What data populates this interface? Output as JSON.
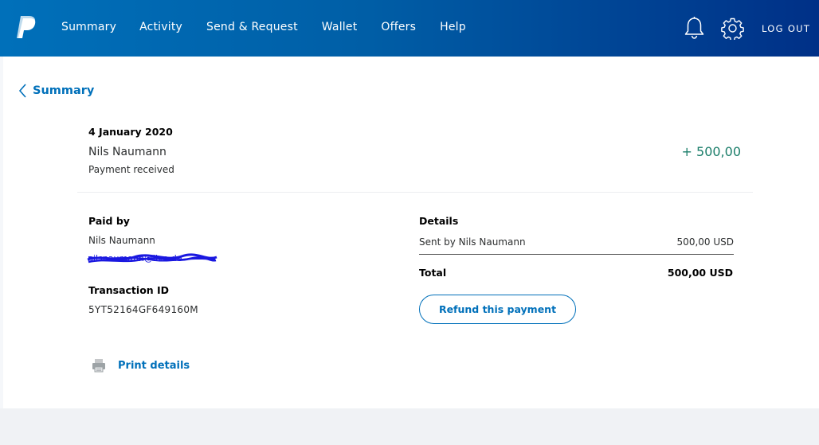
{
  "nav": {
    "items": [
      "Summary",
      "Activity",
      "Send & Request",
      "Wallet",
      "Offers",
      "Help"
    ],
    "logout": "LOG OUT"
  },
  "back": {
    "label": "Summary"
  },
  "transaction": {
    "date": "4 January 2020",
    "name": "Nils Naumann",
    "type": "Payment received",
    "amount": "+ 500,00"
  },
  "paid_by": {
    "label": "Paid by",
    "name": "Nils Naumann",
    "email": "nilsnaumann@live.de"
  },
  "transaction_id": {
    "label": "Transaction ID",
    "value": "5YT52164GF649160M"
  },
  "details": {
    "label": "Details",
    "sent_by_label": "Sent by Nils Naumann",
    "sent_by_amount": "500,00 USD",
    "total_label": "Total",
    "total_amount": "500,00 USD"
  },
  "actions": {
    "refund": "Refund this payment",
    "print": "Print details"
  },
  "colors": {
    "brand_blue": "#0070ba",
    "header_dark": "#003087",
    "amount_green": "#1b7e6a"
  },
  "icons": [
    "paypal-logo-icon",
    "bell-icon",
    "gear-icon",
    "chevron-left-icon",
    "printer-icon"
  ]
}
